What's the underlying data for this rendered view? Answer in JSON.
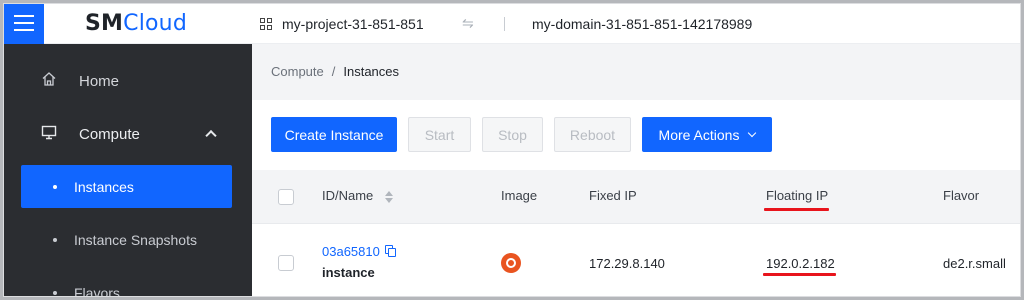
{
  "header": {
    "logo_bold": "SM",
    "logo_rest": "Cloud",
    "project": "my-project-31-851-851",
    "swap_glyph": "⇋",
    "domain": "my-domain-31-851-851-142178989"
  },
  "sidebar": {
    "items": [
      {
        "label": "Home",
        "icon": "home-icon"
      },
      {
        "label": "Compute",
        "icon": "monitor-icon",
        "expanded": true
      }
    ],
    "sub_items": [
      {
        "label": "Instances",
        "active": true
      },
      {
        "label": "Instance Snapshots"
      },
      {
        "label": "Flavors"
      }
    ]
  },
  "breadcrumb": {
    "root": "Compute",
    "separator": "/",
    "current": "Instances"
  },
  "toolbar": {
    "create": "Create Instance",
    "start": "Start",
    "stop": "Stop",
    "reboot": "Reboot",
    "more": "More Actions"
  },
  "table": {
    "columns": [
      "ID/Name",
      "Image",
      "Fixed IP",
      "Floating IP",
      "Flavor"
    ],
    "rows": [
      {
        "id": "03a65810",
        "name": "instance",
        "image": "ubuntu-icon",
        "fixed_ip": "172.29.8.140",
        "floating_ip": "192.0.2.182",
        "flavor": "de2.r.small"
      }
    ]
  },
  "colors": {
    "accent": "#1166ff",
    "sidebar_bg": "#2b2d31",
    "highlight_underline": "#e8141c",
    "ubuntu": "#e95420"
  }
}
